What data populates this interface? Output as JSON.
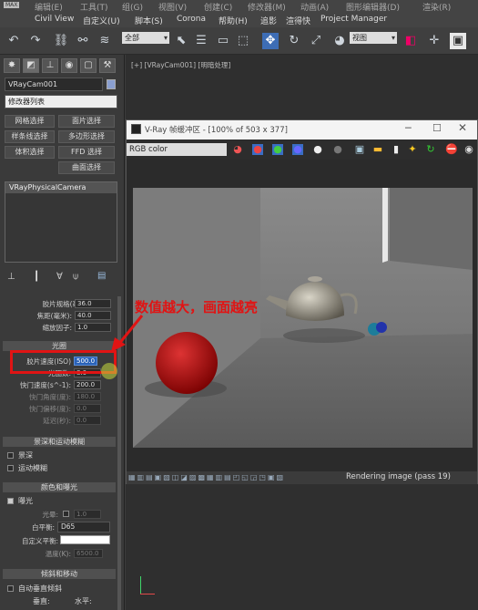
{
  "menubar": {
    "row1": [
      "MAX",
      "编辑(E)",
      "工具(T)",
      "组(G)",
      "视图(V)",
      "创建(C)",
      "修改器(M)",
      "动画(A)",
      "图形编辑器(D)",
      "渲染(R)"
    ],
    "row2": [
      "Civil View",
      "自定义(U)",
      "脚本(S)",
      "Corona",
      "帮助(H)",
      "追影",
      "渲得快",
      "Project Manager"
    ]
  },
  "toolbar": {
    "selection_filter": "全部",
    "view_dropdown": "视图"
  },
  "command_panel": {
    "object_name": "VRayCam001",
    "modifier_list": "修改器列表",
    "buttons": [
      "网格选择",
      "面片选择",
      "样条线选择",
      "多边形选择",
      "体积选择",
      "FFD 选择",
      "曲面选择"
    ],
    "stack_item": "VRayPhysicalCamera",
    "params": [
      {
        "label": "胶片规格(毫米):",
        "value": "36.0"
      },
      {
        "label": "焦距(毫米):",
        "value": "40.0"
      },
      {
        "label": "缩放因子:",
        "value": "1.0"
      }
    ],
    "exposure_rollout": "光圈",
    "exposure_params": [
      {
        "label": "胶片速度(ISO)",
        "value": "500.0"
      },
      {
        "label": "光圈数:",
        "value": "8.0"
      },
      {
        "label": "快门速度(s^-1):",
        "value": "200.0"
      },
      {
        "label": "快门角度(度):",
        "value": "180.0"
      },
      {
        "label": "快门偏移(度):",
        "value": "0.0"
      },
      {
        "label": "延迟(秒):",
        "value": "0.0"
      }
    ],
    "dof_rollout": "景深和运动模糊",
    "dof_checks": [
      "景深",
      "运动模糊"
    ],
    "color_rollout": "颜色和曝光",
    "exposure_check": "曝光",
    "color_params": [
      {
        "label": "光晕:",
        "value": "1.0"
      },
      {
        "label": "白平衡:",
        "value": "D65"
      },
      {
        "label": "自定义平衡:",
        "value": ""
      },
      {
        "label": "温度(K):",
        "value": "6500.0"
      }
    ],
    "tilt_rollout": "倾斜和移动",
    "tilt_check": "自动垂直倾斜",
    "tilt_labels": [
      "垂直:",
      "水平:"
    ]
  },
  "viewport": {
    "label": "[+] [VRayCam001] [明暗处理]"
  },
  "vfb": {
    "title": "V-Ray 帧缓冲区 - [100% of 503 x 377]",
    "channel": "RGB color",
    "status": "Rendering image (pass 19)"
  },
  "annotation": {
    "text": "数值越大，画面越亮",
    "color": "#e01414"
  }
}
